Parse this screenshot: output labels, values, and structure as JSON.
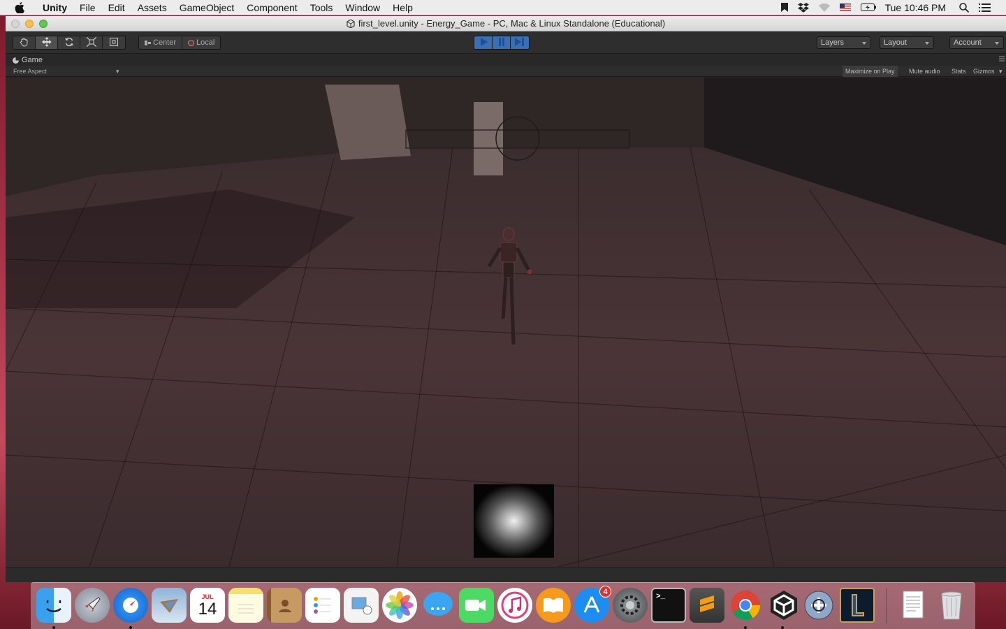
{
  "menubar": {
    "app_name": "Unity",
    "items": [
      "File",
      "Edit",
      "Assets",
      "GameObject",
      "Component",
      "Tools",
      "Window",
      "Help"
    ],
    "clock": "Tue 10:46 PM"
  },
  "window": {
    "title": "first_level.unity - Energy_Game - PC, Mac & Linux Standalone (Educational)"
  },
  "toolbar": {
    "pivot_center": "Center",
    "pivot_local": "Local",
    "layers_label": "Layers",
    "layout_label": "Layout",
    "account_label": "Account"
  },
  "game_view": {
    "tab_label": "Game",
    "aspect_label": "Free Aspect",
    "maximize_label": "Maximize on Play",
    "mute_label": "Mute audio",
    "stats_label": "Stats",
    "gizmos_label": "Gizmos"
  },
  "dock": {
    "calendar_month": "JUL",
    "calendar_day": "14",
    "appstore_badge": "4",
    "terminal_prompt": ">_"
  }
}
